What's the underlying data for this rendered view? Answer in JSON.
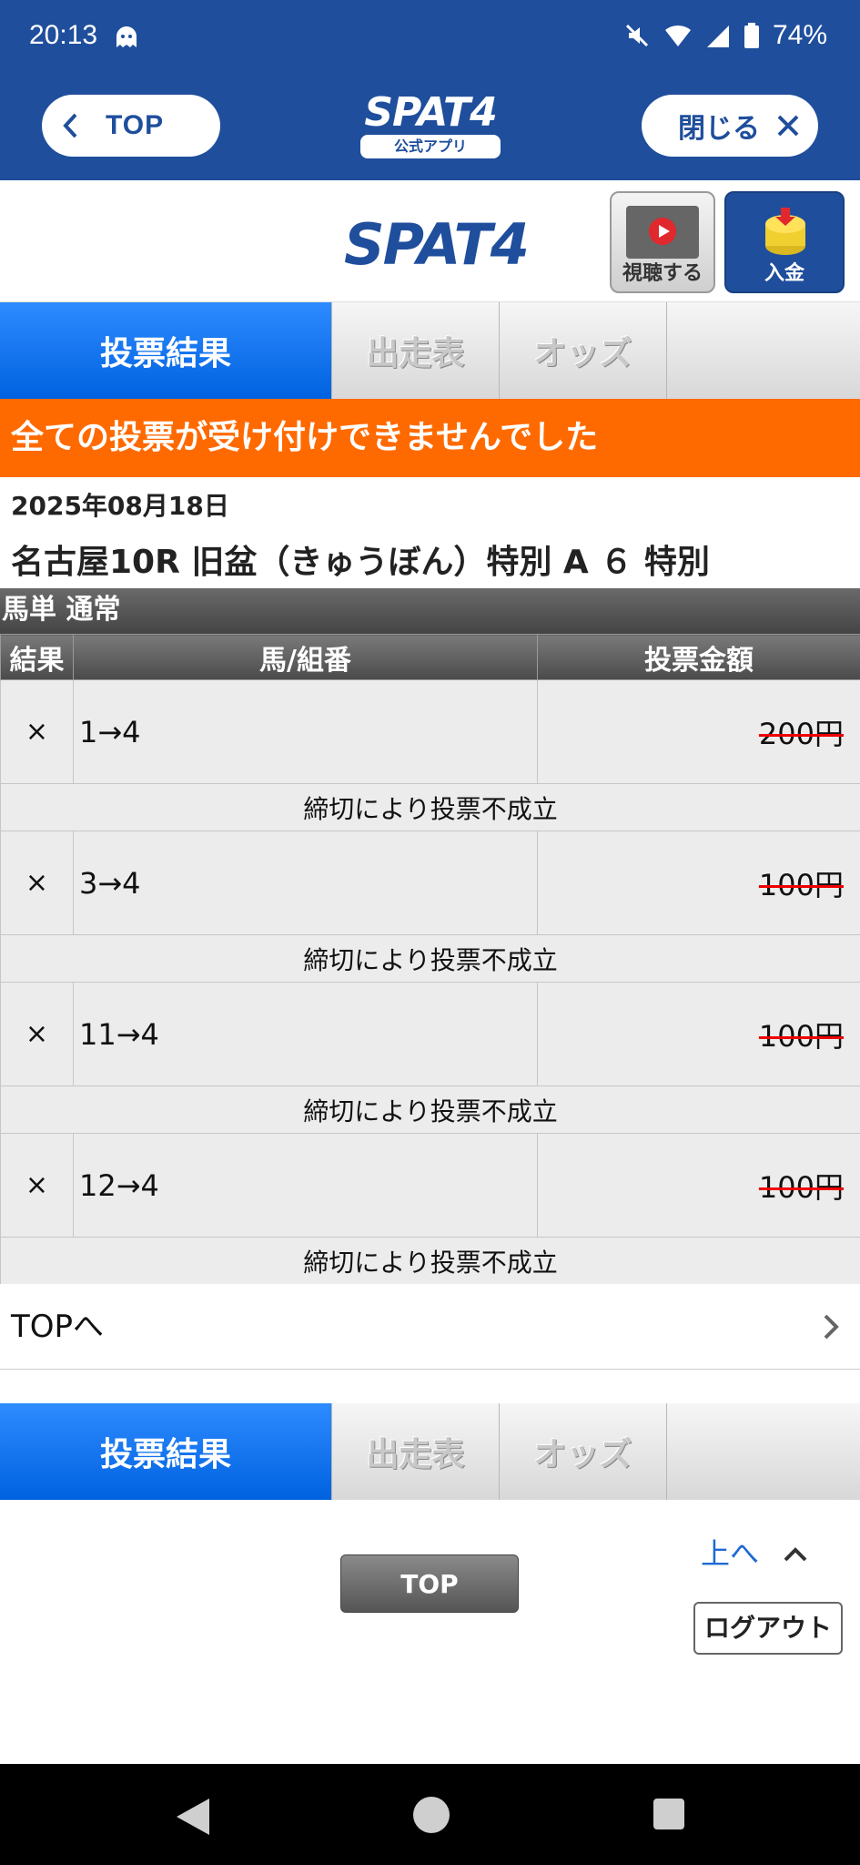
{
  "status": {
    "time": "20:13",
    "battery": "74%",
    "icons": [
      "ghost-notification-icon",
      "mute-icon",
      "wifi-icon",
      "signal-icon",
      "battery-icon"
    ]
  },
  "appbar": {
    "back_label": "TOP",
    "close_label": "閉じる",
    "logo_text": "SPAT4",
    "logo_sub": "公式アプリ"
  },
  "sitehead": {
    "logo_text": "SPAT4",
    "watch_label": "視聴する",
    "deposit_label": "入金"
  },
  "tabs": [
    "投票結果",
    "出走表",
    "オッズ"
  ],
  "banner": "全ての投票が受け付けできませんでした",
  "race": {
    "date": "2025年08月18日",
    "title": "名古屋10R 旧盆（きゅうぼん）特別 A ６ 特別"
  },
  "bet_type": "馬単 通常",
  "table": {
    "headers": [
      "結果",
      "馬/組番",
      "投票金額"
    ],
    "rows": [
      {
        "result": "×",
        "combo": "1→4",
        "amount": "200円",
        "note": "締切により投票不成立"
      },
      {
        "result": "×",
        "combo": "3→4",
        "amount": "100円",
        "note": "締切により投票不成立"
      },
      {
        "result": "×",
        "combo": "11→4",
        "amount": "100円",
        "note": "締切により投票不成立"
      },
      {
        "result": "×",
        "combo": "12→4",
        "amount": "100円",
        "note": "締切により投票不成立"
      }
    ]
  },
  "toplink": "TOPへ",
  "footer": {
    "up_label": "上へ",
    "top_button": "TOP",
    "logout_button": "ログアウト"
  },
  "colors": {
    "brand_blue": "#1f4e9c",
    "active_tab": "#0a74f0",
    "banner_orange": "#ff6a00",
    "error_red": "#d01010"
  }
}
